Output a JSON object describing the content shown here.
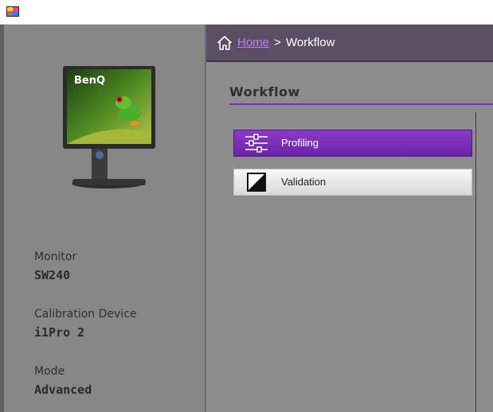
{
  "breadcrumb": {
    "home": "Home",
    "separator": ">",
    "current": "Workflow"
  },
  "section": {
    "title": "Workflow"
  },
  "workflow_buttons": [
    {
      "label": "Profiling",
      "icon": "sliders-icon"
    },
    {
      "label": "Validation",
      "icon": "contrast-square-icon"
    }
  ],
  "device_info": {
    "monitor_label": "Monitor",
    "monitor_value": "SW240",
    "device_label": "Calibration Device",
    "device_value": "i1Pro 2",
    "mode_label": "Mode",
    "mode_value": "Advanced"
  },
  "monitor_image": {
    "brand_text": "BenQ"
  },
  "colors": {
    "accent": "#7b2fb5",
    "breadcrumb_bg": "#5a4f64",
    "link": "#c27cf4"
  }
}
